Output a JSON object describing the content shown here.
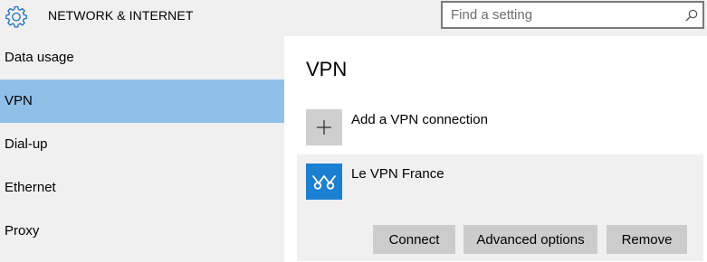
{
  "header": {
    "title": "NETWORK & INTERNET",
    "icon": "gear-icon",
    "background": "#f0f0f0"
  },
  "search": {
    "placeholder": "Find a setting",
    "value": "",
    "icon": "search-icon"
  },
  "sidebar": {
    "background": "#f0f0f0",
    "selected_color": "#90bfe8",
    "items": [
      {
        "label": "Data usage",
        "selected": false
      },
      {
        "label": "VPN",
        "selected": true
      },
      {
        "label": "Dial-up",
        "selected": false
      },
      {
        "label": "Ethernet",
        "selected": false
      },
      {
        "label": "Proxy",
        "selected": false
      }
    ]
  },
  "main": {
    "title": "VPN",
    "add_connection": {
      "label": "Add a VPN connection",
      "icon": "plus-icon"
    },
    "connections": [
      {
        "name": "Le VPN France",
        "icon": "vpn-logo-icon",
        "icon_color": "#1b7fd2",
        "buttons": {
          "connect": "Connect",
          "advanced": "Advanced options",
          "remove": "Remove"
        }
      }
    ]
  }
}
